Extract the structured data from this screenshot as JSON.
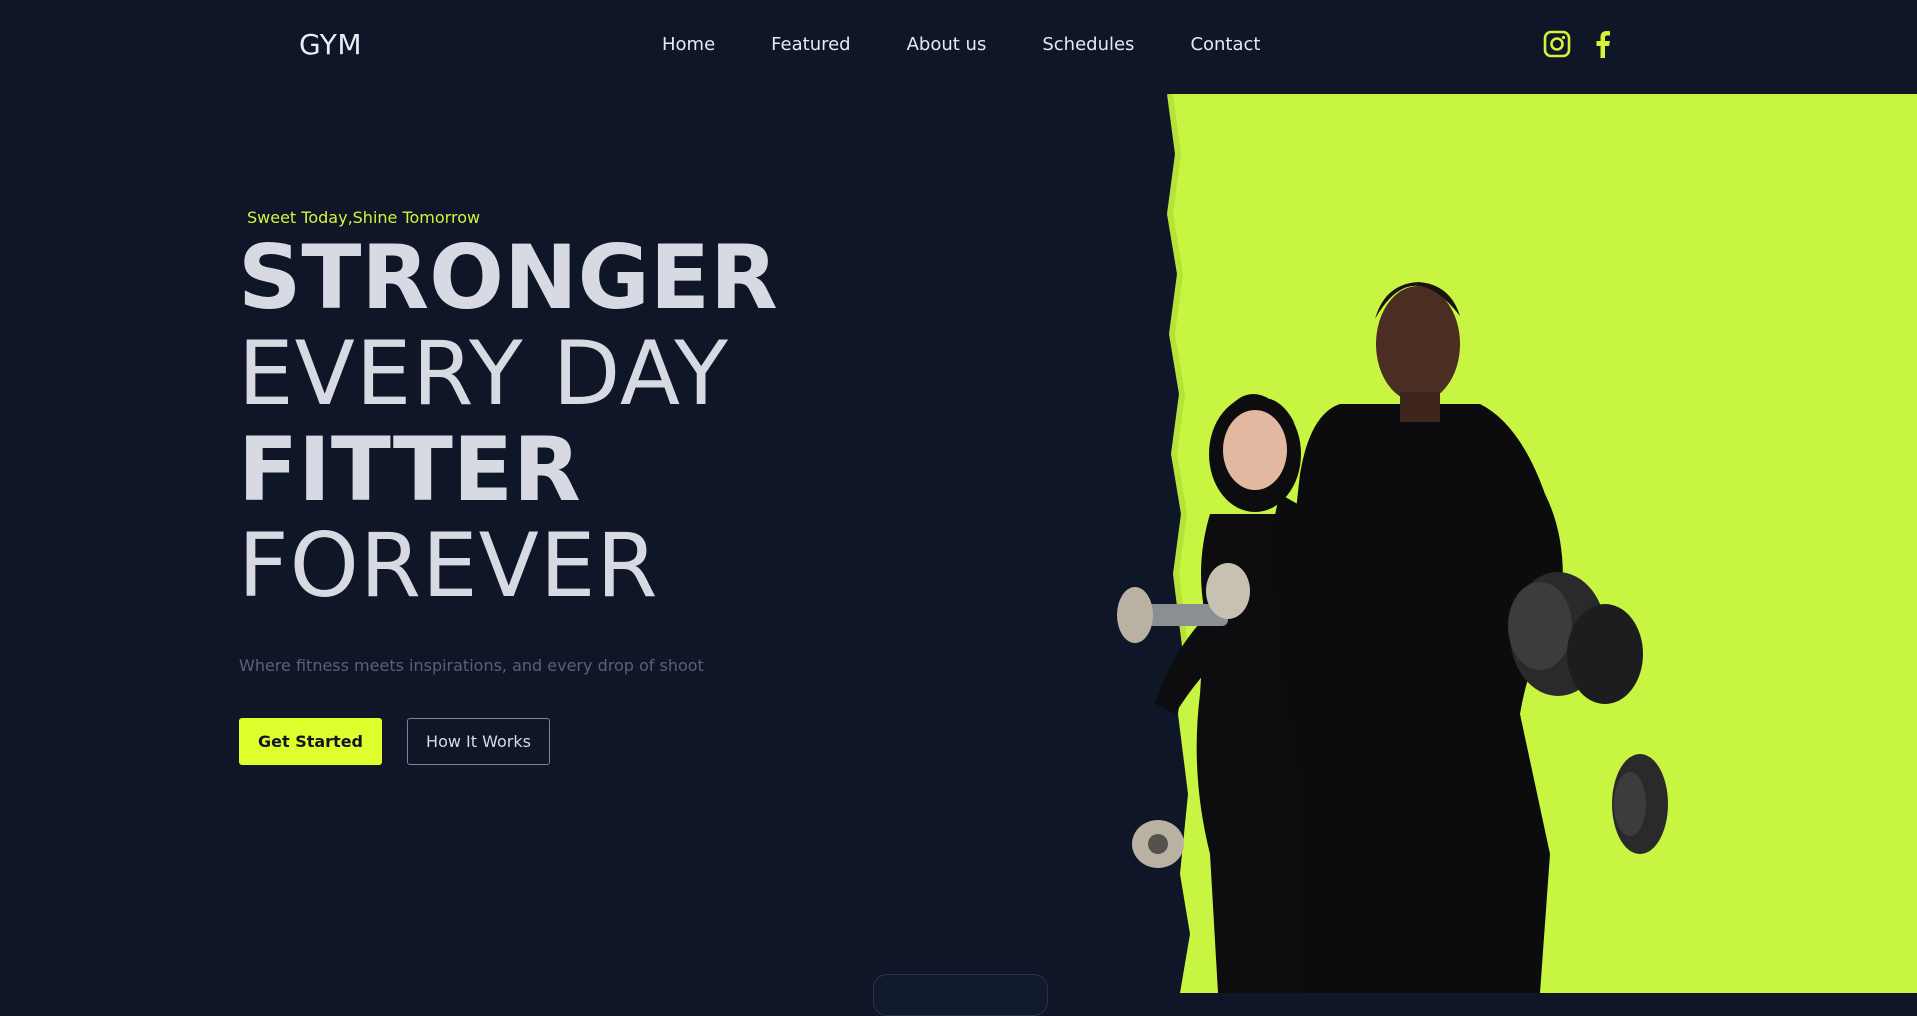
{
  "brand": {
    "logo": "GYM"
  },
  "nav": {
    "items": [
      {
        "label": "Home"
      },
      {
        "label": "Featured"
      },
      {
        "label": "About us"
      },
      {
        "label": "Schedules"
      },
      {
        "label": "Contact"
      }
    ]
  },
  "social": {
    "icons": [
      "instagram-icon",
      "facebook-icon"
    ],
    "accent": "#d8f23a"
  },
  "hero": {
    "tagline": "Sweet Today,Shine Tomorrow",
    "line1": "STRONGER",
    "line2": "EVERY DAY",
    "line3": "FITTER",
    "line4": "FOREVER",
    "subtitle": "Where fitness meets inspirations, and every drop of shoot",
    "primary_button": "Get Started",
    "secondary_button": "How It Works"
  },
  "colors": {
    "background": "#0e1628",
    "accent": "#dfff2c",
    "image_background": "#c8f542"
  }
}
